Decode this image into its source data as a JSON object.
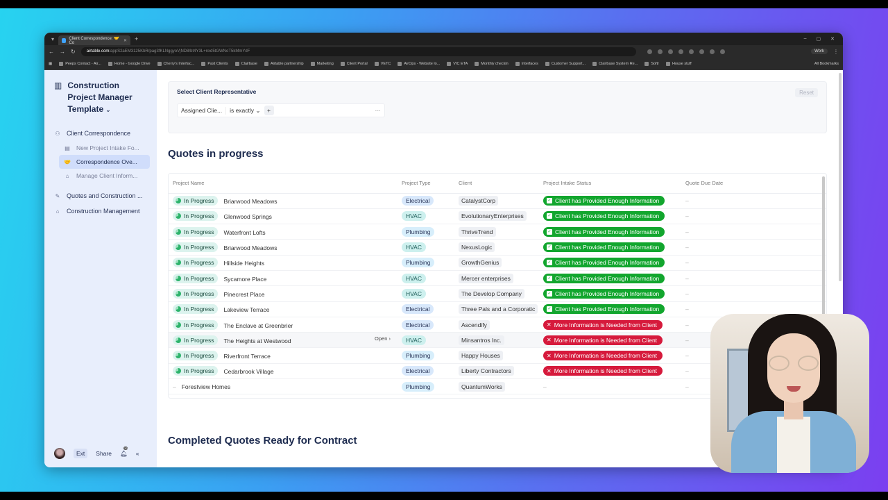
{
  "browser": {
    "tab_title": "Client Correspondence: 🤝 Co",
    "url_host": "airtable.com",
    "url_path": "/appS2aEM3125KbR/pag3fKLNggyoVjND8/bt4Y3L+nxd5tGWNoT5kMmYdF",
    "profile": "Work",
    "bookmarks": [
      "Peeps Contact - Air...",
      "Home - Google Drive",
      "Cherry's Interfac...",
      "Past Clients",
      "Clairbase",
      "Airtable partnership",
      "Marketing",
      "Client Portal",
      "VETC",
      "AirOps - Website lo...",
      "VIC ETA",
      "Monthly checkin",
      "Interfaces",
      "Customer Support...",
      "Clairbase System Re...",
      "Softr",
      "House stuff"
    ],
    "all_bookmarks": "All Bookmarks"
  },
  "sidebar": {
    "title": "Construction Project Manager Template",
    "groups": [
      {
        "label": "Client Correspondence"
      },
      {
        "label": "Quotes and Construction ..."
      },
      {
        "label": "Construction Management"
      }
    ],
    "sub_items": [
      {
        "label": "New Project Intake Fo..."
      },
      {
        "label": "Correspondence Ove..."
      },
      {
        "label": "Manage Client Inform..."
      }
    ],
    "footer": {
      "ext": "Ext",
      "share": "Share",
      "notif_count": "10"
    }
  },
  "filter": {
    "title": "Select Client Representative",
    "reset": "Reset",
    "field": "Assigned Clie...",
    "operator": "is exactly",
    "more": "···"
  },
  "quotes": {
    "title": "Quotes in progress",
    "columns": [
      "Project Name",
      "Project Type",
      "Client",
      "Project Intake Status",
      "Quote Due Date"
    ],
    "open_label": "Open",
    "rows": [
      {
        "status": "In Progress",
        "name": "Briarwood Meadows",
        "type": "Electrical",
        "client": "CatalystCorp",
        "intake": "Client has Provided Enough Information",
        "due": "–"
      },
      {
        "status": "In Progress",
        "name": "Glenwood Springs",
        "type": "HVAC",
        "client": "EvolutionaryEnterprises",
        "intake": "Client has Provided Enough Information",
        "due": "–"
      },
      {
        "status": "In Progress",
        "name": "Waterfront Lofts",
        "type": "Plumbing",
        "client": "ThriveTrend",
        "intake": "Client has Provided Enough Information",
        "due": "–"
      },
      {
        "status": "In Progress",
        "name": "Briarwood Meadows",
        "type": "HVAC",
        "client": "NexusLogic",
        "intake": "Client has Provided Enough Information",
        "due": "–"
      },
      {
        "status": "In Progress",
        "name": "Hillside Heights",
        "type": "Plumbing",
        "client": "GrowthGenius",
        "intake": "Client has Provided Enough Information",
        "due": "–"
      },
      {
        "status": "In Progress",
        "name": "Sycamore Place",
        "type": "HVAC",
        "client": "Mercer enterprises",
        "intake": "Client has Provided Enough Information",
        "due": "–"
      },
      {
        "status": "In Progress",
        "name": "Pinecrest Place",
        "type": "HVAC",
        "client": "The Develop Company",
        "intake": "Client has Provided Enough Information",
        "due": "–"
      },
      {
        "status": "In Progress",
        "name": "Lakeview Terrace",
        "type": "Electrical",
        "client": "Three Pals and a Corporatic",
        "intake": "Client has Provided Enough Information",
        "due": "–"
      },
      {
        "status": "In Progress",
        "name": "The Enclave at Greenbrier",
        "type": "Electrical",
        "client": "Ascendify",
        "intake": "More Information is Needed from Client",
        "due": "–"
      },
      {
        "status": "In Progress",
        "name": "The Heights at Westwood",
        "type": "HVAC",
        "client": "Minsantros Inc.",
        "intake": "More Information is Needed from Client",
        "due": "–"
      },
      {
        "status": "In Progress",
        "name": "Riverfront Terrace",
        "type": "Plumbing",
        "client": "Happy Houses",
        "intake": "More Information is Needed from Client",
        "due": "–"
      },
      {
        "status": "In Progress",
        "name": "Cedarbrook Village",
        "type": "Electrical",
        "client": "Liberty Contractors",
        "intake": "More Information is Needed from Client",
        "due": "–"
      },
      {
        "status": "–",
        "name": "Forestview Homes",
        "type": "Plumbing",
        "client": "QuantumWorks",
        "intake": "–",
        "due": "–"
      }
    ]
  },
  "completed": {
    "title": "Completed Quotes Ready for Contract"
  },
  "colors": {
    "ok": "#12a62e",
    "bad": "#d61a3c",
    "sidebar_bg": "#e8eefc"
  }
}
